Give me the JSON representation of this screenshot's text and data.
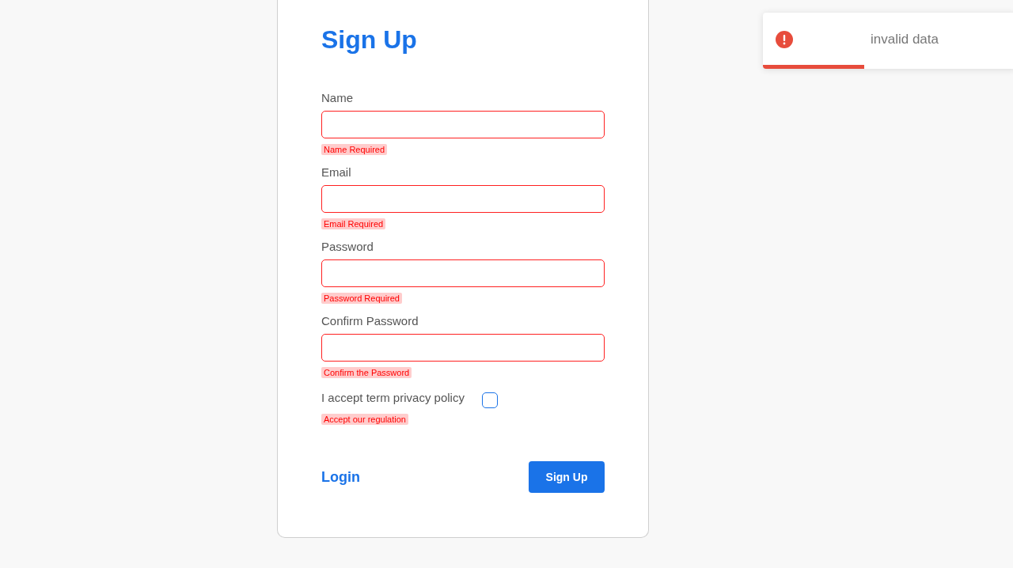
{
  "form": {
    "title": "Sign Up",
    "fields": [
      {
        "label": "Name",
        "error": "Name Required",
        "invalid": true
      },
      {
        "label": "Email",
        "error": "Email Required",
        "invalid": true
      },
      {
        "label": "Password",
        "error": "Password Required",
        "invalid": true
      },
      {
        "label": "Confirm Password",
        "error": "Confirm the Password",
        "invalid": true
      }
    ],
    "terms": {
      "label": "I accept term privacy policy",
      "checked": false,
      "error": "Accept our regulation"
    },
    "login_link": "Login",
    "submit_button": "Sign Up"
  },
  "toast": {
    "message": "invalid data",
    "level": 0.4
  }
}
